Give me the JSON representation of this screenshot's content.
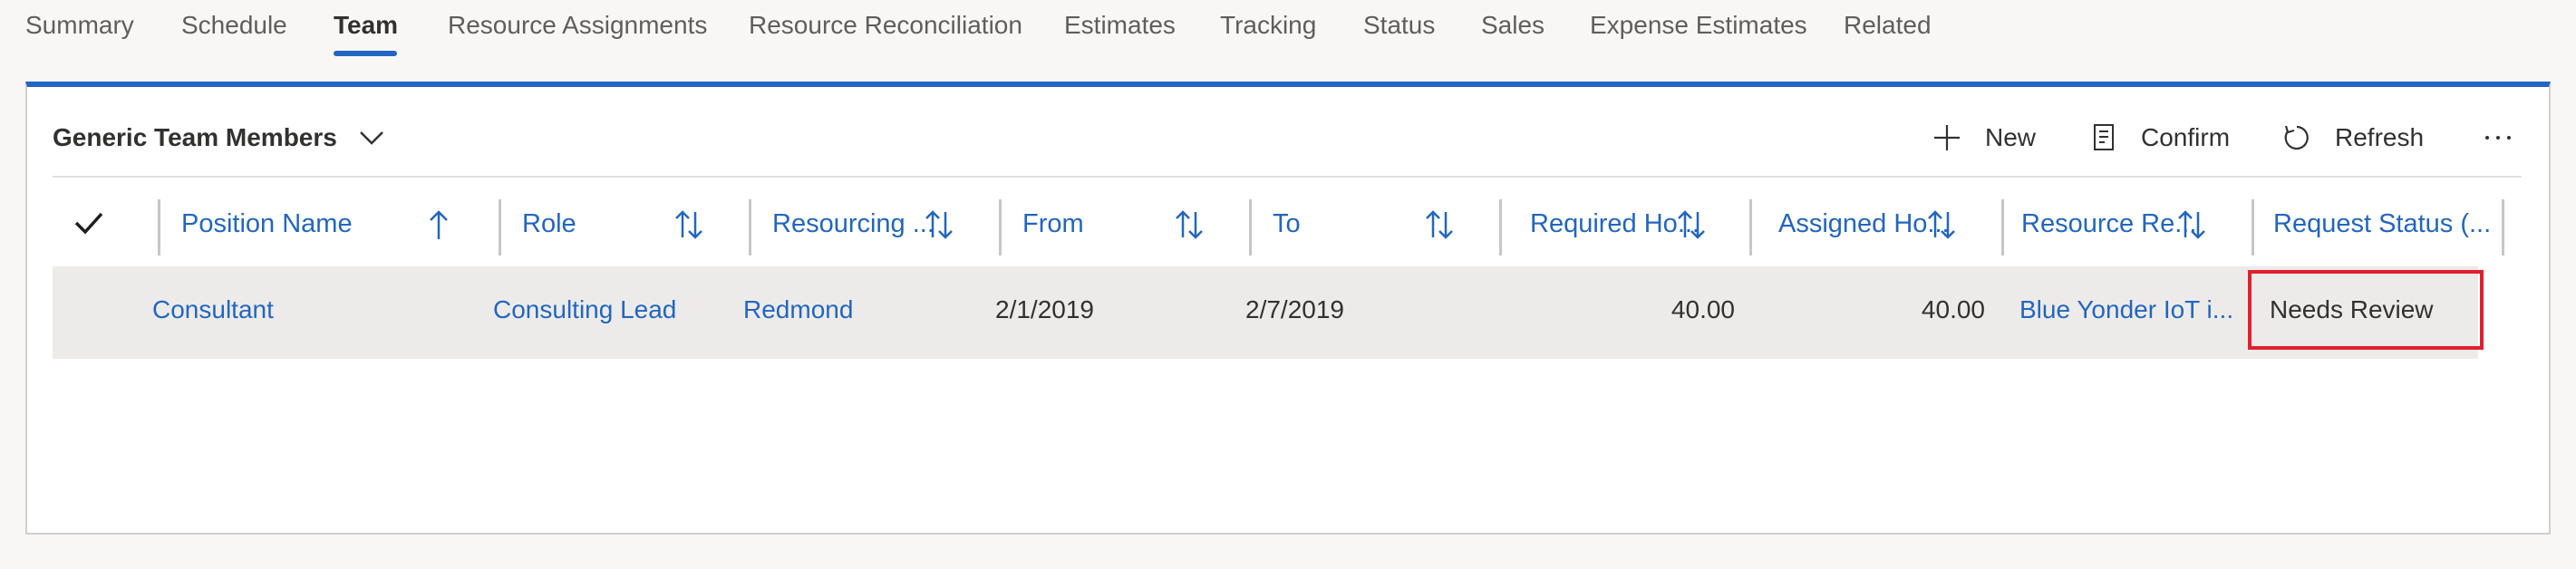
{
  "tabs": [
    {
      "label": "Summary"
    },
    {
      "label": "Schedule"
    },
    {
      "label": "Team"
    },
    {
      "label": "Resource Assignments"
    },
    {
      "label": "Resource Reconciliation"
    },
    {
      "label": "Estimates"
    },
    {
      "label": "Tracking"
    },
    {
      "label": "Status"
    },
    {
      "label": "Sales"
    },
    {
      "label": "Expense Estimates"
    },
    {
      "label": "Related"
    }
  ],
  "active_tab": "Team",
  "section": {
    "title": "Generic Team Members",
    "commands": {
      "new": "New",
      "confirm": "Confirm",
      "refresh": "Refresh"
    }
  },
  "columns": [
    {
      "label": "Position Name",
      "sort": "ascending"
    },
    {
      "label": "Role",
      "sort": "none"
    },
    {
      "label": "Resourcing ...",
      "sort": "none"
    },
    {
      "label": "From",
      "sort": "none"
    },
    {
      "label": "To",
      "sort": "none"
    },
    {
      "label": "Required Ho...",
      "sort": "none"
    },
    {
      "label": "Assigned Ho...",
      "sort": "none"
    },
    {
      "label": "Resource Re...",
      "sort": "none"
    },
    {
      "label": "Request Status (...",
      "sort": "none"
    }
  ],
  "rows": [
    {
      "position_name": "Consultant",
      "role": "Consulting Lead",
      "resourcing_unit": "Redmond",
      "from": "2/1/2019",
      "to": "2/7/2019",
      "required_hours": "40.00",
      "assigned_hours": "40.00",
      "resource_request": "Blue Yonder IoT i...",
      "request_status": "Needs Review"
    }
  ],
  "colors": {
    "accent": "#2266c1",
    "highlight_border": "#e0202e",
    "row_background": "#edebe9"
  }
}
